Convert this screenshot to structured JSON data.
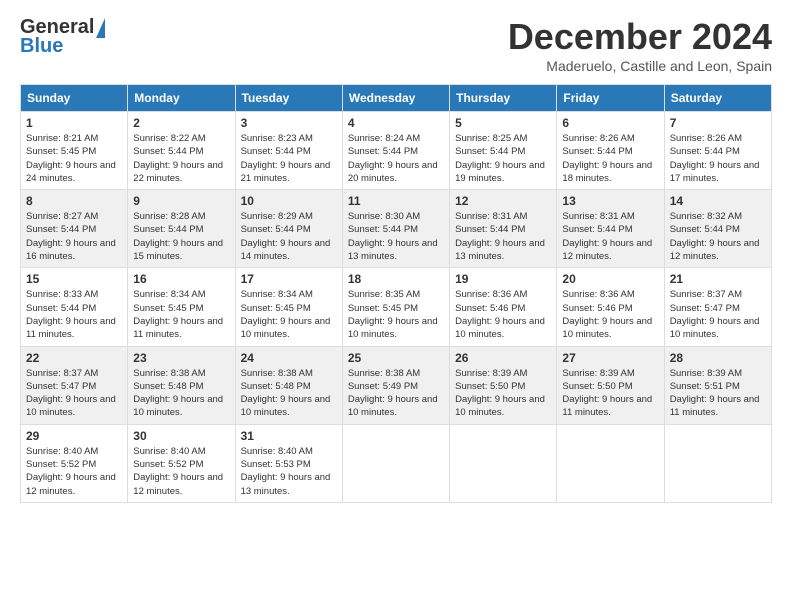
{
  "logo": {
    "general": "General",
    "blue": "Blue"
  },
  "header": {
    "month": "December 2024",
    "location": "Maderuelo, Castille and Leon, Spain"
  },
  "weekdays": [
    "Sunday",
    "Monday",
    "Tuesday",
    "Wednesday",
    "Thursday",
    "Friday",
    "Saturday"
  ],
  "weeks": [
    [
      {
        "day": "1",
        "sunrise": "Sunrise: 8:21 AM",
        "sunset": "Sunset: 5:45 PM",
        "daylight": "Daylight: 9 hours and 24 minutes."
      },
      {
        "day": "2",
        "sunrise": "Sunrise: 8:22 AM",
        "sunset": "Sunset: 5:44 PM",
        "daylight": "Daylight: 9 hours and 22 minutes."
      },
      {
        "day": "3",
        "sunrise": "Sunrise: 8:23 AM",
        "sunset": "Sunset: 5:44 PM",
        "daylight": "Daylight: 9 hours and 21 minutes."
      },
      {
        "day": "4",
        "sunrise": "Sunrise: 8:24 AM",
        "sunset": "Sunset: 5:44 PM",
        "daylight": "Daylight: 9 hours and 20 minutes."
      },
      {
        "day": "5",
        "sunrise": "Sunrise: 8:25 AM",
        "sunset": "Sunset: 5:44 PM",
        "daylight": "Daylight: 9 hours and 19 minutes."
      },
      {
        "day": "6",
        "sunrise": "Sunrise: 8:26 AM",
        "sunset": "Sunset: 5:44 PM",
        "daylight": "Daylight: 9 hours and 18 minutes."
      },
      {
        "day": "7",
        "sunrise": "Sunrise: 8:26 AM",
        "sunset": "Sunset: 5:44 PM",
        "daylight": "Daylight: 9 hours and 17 minutes."
      }
    ],
    [
      {
        "day": "8",
        "sunrise": "Sunrise: 8:27 AM",
        "sunset": "Sunset: 5:44 PM",
        "daylight": "Daylight: 9 hours and 16 minutes."
      },
      {
        "day": "9",
        "sunrise": "Sunrise: 8:28 AM",
        "sunset": "Sunset: 5:44 PM",
        "daylight": "Daylight: 9 hours and 15 minutes."
      },
      {
        "day": "10",
        "sunrise": "Sunrise: 8:29 AM",
        "sunset": "Sunset: 5:44 PM",
        "daylight": "Daylight: 9 hours and 14 minutes."
      },
      {
        "day": "11",
        "sunrise": "Sunrise: 8:30 AM",
        "sunset": "Sunset: 5:44 PM",
        "daylight": "Daylight: 9 hours and 13 minutes."
      },
      {
        "day": "12",
        "sunrise": "Sunrise: 8:31 AM",
        "sunset": "Sunset: 5:44 PM",
        "daylight": "Daylight: 9 hours and 13 minutes."
      },
      {
        "day": "13",
        "sunrise": "Sunrise: 8:31 AM",
        "sunset": "Sunset: 5:44 PM",
        "daylight": "Daylight: 9 hours and 12 minutes."
      },
      {
        "day": "14",
        "sunrise": "Sunrise: 8:32 AM",
        "sunset": "Sunset: 5:44 PM",
        "daylight": "Daylight: 9 hours and 12 minutes."
      }
    ],
    [
      {
        "day": "15",
        "sunrise": "Sunrise: 8:33 AM",
        "sunset": "Sunset: 5:44 PM",
        "daylight": "Daylight: 9 hours and 11 minutes."
      },
      {
        "day": "16",
        "sunrise": "Sunrise: 8:34 AM",
        "sunset": "Sunset: 5:45 PM",
        "daylight": "Daylight: 9 hours and 11 minutes."
      },
      {
        "day": "17",
        "sunrise": "Sunrise: 8:34 AM",
        "sunset": "Sunset: 5:45 PM",
        "daylight": "Daylight: 9 hours and 10 minutes."
      },
      {
        "day": "18",
        "sunrise": "Sunrise: 8:35 AM",
        "sunset": "Sunset: 5:45 PM",
        "daylight": "Daylight: 9 hours and 10 minutes."
      },
      {
        "day": "19",
        "sunrise": "Sunrise: 8:36 AM",
        "sunset": "Sunset: 5:46 PM",
        "daylight": "Daylight: 9 hours and 10 minutes."
      },
      {
        "day": "20",
        "sunrise": "Sunrise: 8:36 AM",
        "sunset": "Sunset: 5:46 PM",
        "daylight": "Daylight: 9 hours and 10 minutes."
      },
      {
        "day": "21",
        "sunrise": "Sunrise: 8:37 AM",
        "sunset": "Sunset: 5:47 PM",
        "daylight": "Daylight: 9 hours and 10 minutes."
      }
    ],
    [
      {
        "day": "22",
        "sunrise": "Sunrise: 8:37 AM",
        "sunset": "Sunset: 5:47 PM",
        "daylight": "Daylight: 9 hours and 10 minutes."
      },
      {
        "day": "23",
        "sunrise": "Sunrise: 8:38 AM",
        "sunset": "Sunset: 5:48 PM",
        "daylight": "Daylight: 9 hours and 10 minutes."
      },
      {
        "day": "24",
        "sunrise": "Sunrise: 8:38 AM",
        "sunset": "Sunset: 5:48 PM",
        "daylight": "Daylight: 9 hours and 10 minutes."
      },
      {
        "day": "25",
        "sunrise": "Sunrise: 8:38 AM",
        "sunset": "Sunset: 5:49 PM",
        "daylight": "Daylight: 9 hours and 10 minutes."
      },
      {
        "day": "26",
        "sunrise": "Sunrise: 8:39 AM",
        "sunset": "Sunset: 5:50 PM",
        "daylight": "Daylight: 9 hours and 10 minutes."
      },
      {
        "day": "27",
        "sunrise": "Sunrise: 8:39 AM",
        "sunset": "Sunset: 5:50 PM",
        "daylight": "Daylight: 9 hours and 11 minutes."
      },
      {
        "day": "28",
        "sunrise": "Sunrise: 8:39 AM",
        "sunset": "Sunset: 5:51 PM",
        "daylight": "Daylight: 9 hours and 11 minutes."
      }
    ],
    [
      {
        "day": "29",
        "sunrise": "Sunrise: 8:40 AM",
        "sunset": "Sunset: 5:52 PM",
        "daylight": "Daylight: 9 hours and 12 minutes."
      },
      {
        "day": "30",
        "sunrise": "Sunrise: 8:40 AM",
        "sunset": "Sunset: 5:52 PM",
        "daylight": "Daylight: 9 hours and 12 minutes."
      },
      {
        "day": "31",
        "sunrise": "Sunrise: 8:40 AM",
        "sunset": "Sunset: 5:53 PM",
        "daylight": "Daylight: 9 hours and 13 minutes."
      },
      null,
      null,
      null,
      null
    ]
  ]
}
